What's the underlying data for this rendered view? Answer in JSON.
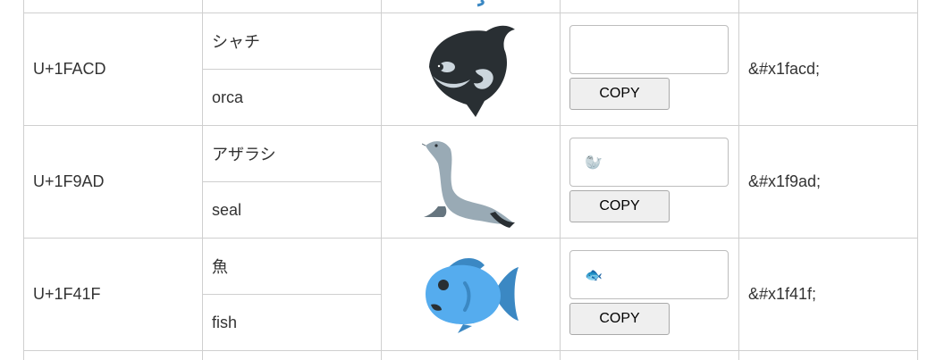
{
  "rows": [
    {
      "code": "U+1FACD",
      "name_ja": "シャチ",
      "name_en": "orca",
      "emoji_icon": "orca-icon",
      "field_value": "",
      "copy_label": "COPY",
      "entity": "&#x1facd;"
    },
    {
      "code": "U+1F9AD",
      "name_ja": "アザラシ",
      "name_en": "seal",
      "emoji_icon": "seal-icon",
      "field_value": "🦭",
      "copy_label": "COPY",
      "entity": "&#x1f9ad;"
    },
    {
      "code": "U+1F41F",
      "name_ja": "魚",
      "name_en": "fish",
      "emoji_icon": "fish-icon",
      "field_value": "🐟",
      "copy_label": "COPY",
      "entity": "&#x1f41f;"
    }
  ],
  "colors": {
    "border": "#cfcfcf",
    "button_bg": "#efefef",
    "fish_blue": "#55acee",
    "orca_dark": "#292f33"
  }
}
